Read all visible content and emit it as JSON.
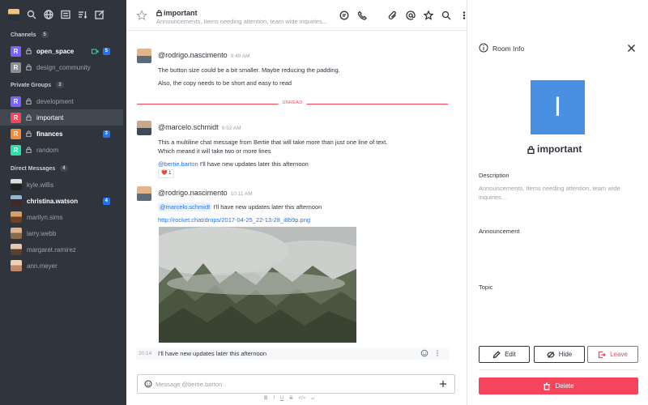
{
  "sidebar": {
    "sections": {
      "channels": {
        "label": "Channels",
        "count": "5"
      },
      "private": {
        "label": "Private Groups",
        "count": "3"
      },
      "direct": {
        "label": "Direct Messages",
        "count": "4"
      }
    },
    "channels": [
      {
        "letter": "R",
        "name": "open_space",
        "badge": "5",
        "color": "#7b61ff"
      },
      {
        "letter": "R",
        "name": "design_community",
        "color": "#8e8e93"
      }
    ],
    "groups": [
      {
        "letter": "R",
        "name": "development",
        "color": "#7b61ff"
      },
      {
        "letter": "R",
        "name": "important",
        "color": "#f5455c"
      },
      {
        "letter": "R",
        "name": "finances",
        "badge": "3",
        "color": "#f38c39"
      },
      {
        "letter": "R",
        "name": "random",
        "color": "#2de0a5"
      }
    ],
    "dms": [
      {
        "name": "kyle.willis"
      },
      {
        "name": "christina.watson",
        "badge": "4"
      },
      {
        "name": "marilyn.sims"
      },
      {
        "name": "larry.webb"
      },
      {
        "name": "margaret.ramirez"
      },
      {
        "name": "ann.meyer"
      }
    ]
  },
  "header": {
    "title": "important",
    "subtitle": "Announcements, Items needing attention, team wide inquiries..."
  },
  "messages": [
    {
      "user": "@rodrigo.nascimento",
      "time": "9:49 AM",
      "lines": [
        "The button size could be a bit smaller. Maybe reducing the padding.",
        "Also, the copy needs to be short and easy to read"
      ]
    },
    {
      "user": "@marcelo.schmidt",
      "time": "9:52 AM",
      "lines": [
        "This a multiline chat message from Bertie that will take more than just one line of text.",
        "Which meand it will take two or more lines"
      ],
      "mention": "@bertie.barton",
      "mention_text": " I'll have new updates later this afternoon",
      "reaction": "❤️ 1"
    },
    {
      "user": "@rodrigo.nascimento",
      "time": "10:11 AM",
      "mention": "@marcelo.schmidt",
      "mention_text": "  I'll have new updates later this afternoon",
      "link": "http://rocket.chat/drops/2017-04-25_22-13-28_i8b9p.png"
    }
  ],
  "unread_label": "UNREAD",
  "followup": {
    "time": "20:14",
    "text": "I'll have new updates later this afternoon"
  },
  "composer": {
    "placeholder": "Message @bertie.barton",
    "format_icons": [
      "B",
      "I",
      "U",
      "S",
      "</>",
      "↵"
    ]
  },
  "room_info": {
    "title": "Room Info",
    "avatar_letter": "I",
    "name": "important",
    "description_label": "Description",
    "description": "Announcements, Items needing attention, team wide inquiries...",
    "announcement_label": "Announcement",
    "topic_label": "Topic",
    "edit": "Edit",
    "hide": "Hide",
    "leave": "Leave",
    "delete": "Delete"
  },
  "colors": {
    "sidebar_bg": "#2f343d",
    "accent": "#1d74f5",
    "danger": "#f5455c",
    "room_avatar": "#4a90e2"
  }
}
